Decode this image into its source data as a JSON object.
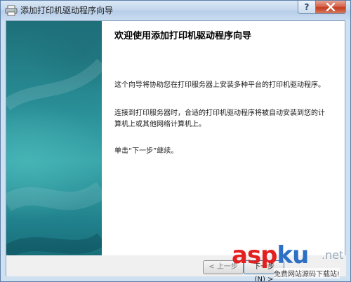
{
  "window": {
    "title": "添加打印机驱动程序向导",
    "help_label": "?"
  },
  "wizard": {
    "heading": "欢迎使用添加打印机驱动程序向导",
    "paragraphs": [
      "这个向导将协助您在打印服务器上安装多种平台的打印机驱动程序。",
      "连接到打印服务器时，合适的打印机驱动程序将被自动安装到您的计算机上或其他网络计算机上。",
      "单击“下一步”继续。"
    ]
  },
  "buttons": {
    "back_label": "< 上一步",
    "next_label": "下一步(N) >"
  },
  "watermark": {
    "asp": "asp",
    "ku": "ku",
    "net": ".net",
    "sub": "免费网站源码下载站!"
  },
  "colors": {
    "side_panel": "#2a8f98",
    "title_bar": "#c2d6ec",
    "close_button": "#c43b1f",
    "watermark_red": "#e41f1f",
    "watermark_blue": "#2d6fc4"
  },
  "icons": {
    "title_icon": "printer-icon",
    "close_icon": "close-icon"
  }
}
